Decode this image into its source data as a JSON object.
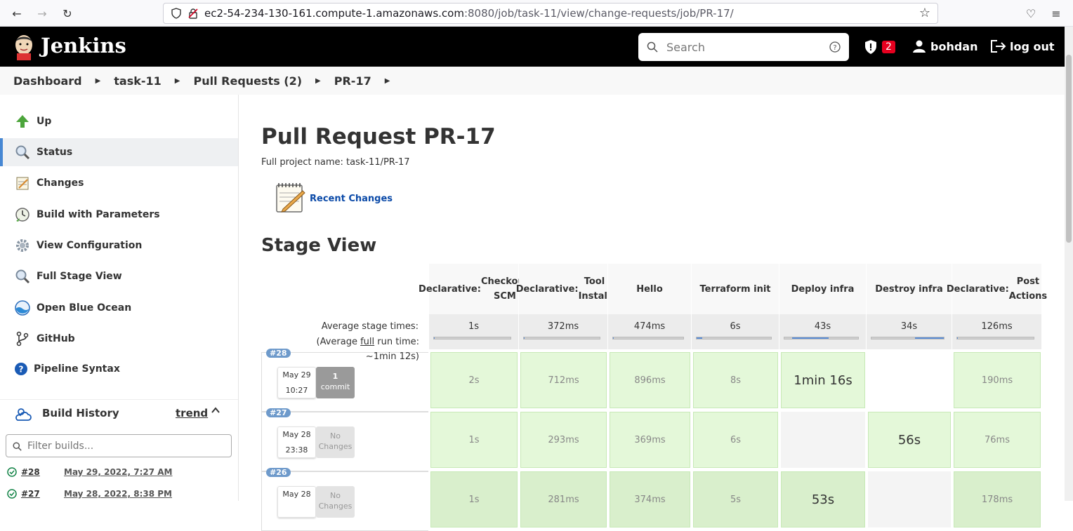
{
  "browser": {
    "url_host": "ec2-54-234-130-161.compute-1.amazonaws.com",
    "url_rest": ":8080/job/task-11/view/change-requests/job/PR-17/"
  },
  "header": {
    "logo": "Jenkins",
    "search_placeholder": "Search",
    "alerts_count": "2",
    "user": "bohdan",
    "logout": "log out"
  },
  "breadcrumb": [
    "Dashboard",
    "task-11",
    "Pull Requests (2)",
    "PR-17"
  ],
  "sidebar": {
    "items": [
      {
        "label": "Up",
        "icon": "up-arrow-icon"
      },
      {
        "label": "Status",
        "icon": "magnifier-icon"
      },
      {
        "label": "Changes",
        "icon": "notepad-icon"
      },
      {
        "label": "Build with Parameters",
        "icon": "clock-icon"
      },
      {
        "label": "View Configuration",
        "icon": "gear-icon"
      },
      {
        "label": "Full Stage View",
        "icon": "magnifier-icon"
      },
      {
        "label": "Open Blue Ocean",
        "icon": "blue-ocean-icon"
      },
      {
        "label": "GitHub",
        "icon": "git-branch-icon"
      },
      {
        "label": "Pipeline Syntax",
        "icon": "help-icon"
      }
    ],
    "build_history": {
      "title": "Build History",
      "trend": "trend",
      "filter_placeholder": "Filter builds...",
      "builds": [
        {
          "num": "#28",
          "date": "May 29, 2022, 7:27 AM"
        },
        {
          "num": "#27",
          "date": "May 28, 2022, 8:38 PM"
        }
      ]
    }
  },
  "main": {
    "title": "Pull Request PR-17",
    "full_name": "Full project name: task-11/PR-17",
    "recent_changes": "Recent Changes",
    "stage_view_title": "Stage View",
    "avg_label": "Average stage times:",
    "avg_run_prefix": "(Average ",
    "avg_run_full": "full",
    "avg_run_suffix": " run time: ~1min 12s)",
    "stages": [
      {
        "line1": "Declarative:",
        "line2": "Checkout SCM",
        "avg": "1s",
        "avg_fill": [
          0,
          0.01
        ]
      },
      {
        "line1": "Declarative:",
        "line2": "Tool Install",
        "avg": "372ms",
        "avg_fill": [
          0,
          0.01
        ]
      },
      {
        "line1": "Hello",
        "line2": "",
        "avg": "474ms",
        "avg_fill": [
          0,
          0.01
        ]
      },
      {
        "line1": "Terraform init",
        "line2": "",
        "avg": "6s",
        "avg_fill": [
          0,
          0.08
        ]
      },
      {
        "line1": "Deploy infra",
        "line2": "",
        "avg": "43s",
        "avg_fill": [
          0.1,
          0.6
        ]
      },
      {
        "line1": "Destroy infra",
        "line2": "",
        "avg": "34s",
        "avg_fill": [
          0.6,
          1.0
        ]
      },
      {
        "line1": "Declarative:",
        "line2": "Post Actions",
        "avg": "126ms",
        "avg_fill": [
          0,
          0.01
        ]
      }
    ],
    "runs": [
      {
        "badge": "#28",
        "date": "May 29",
        "time": "10:27",
        "changes_a": "1",
        "changes_b": "commit",
        "cells": [
          "2s",
          "712ms",
          "896ms",
          "8s",
          "1min 16s",
          "",
          "190ms"
        ]
      },
      {
        "badge": "#27",
        "date": "May 28",
        "time": "23:38",
        "changes_a": "No",
        "changes_b": "Changes",
        "cells": [
          "1s",
          "293ms",
          "369ms",
          "6s",
          "",
          "56s",
          "76ms"
        ]
      },
      {
        "badge": "#26",
        "date": "May 28",
        "time": "",
        "changes_a": "No",
        "changes_b": "Changes",
        "cells": [
          "1s",
          "281ms",
          "374ms",
          "5s",
          "53s",
          "",
          "178ms"
        ]
      }
    ]
  }
}
